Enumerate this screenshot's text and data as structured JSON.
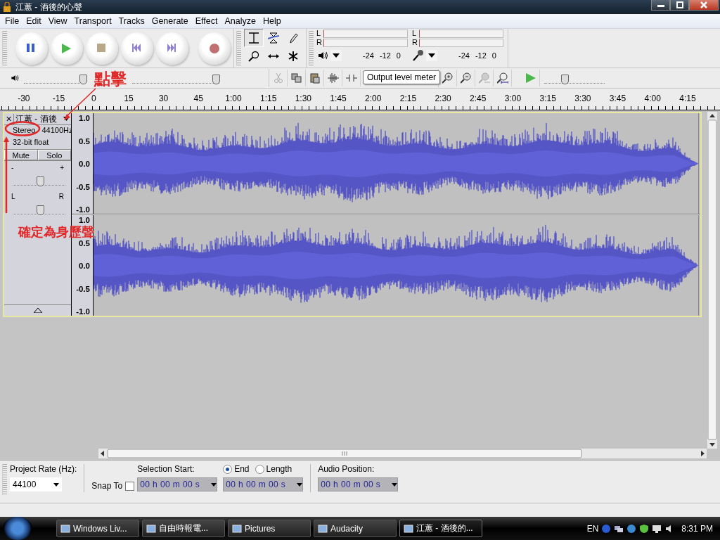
{
  "window": {
    "title": "江蕙 - 酒後的心聲"
  },
  "menu": [
    "File",
    "Edit",
    "View",
    "Transport",
    "Tracks",
    "Generate",
    "Effect",
    "Analyze",
    "Help"
  ],
  "transport": [
    {
      "kind": "pause"
    },
    {
      "kind": "play"
    },
    {
      "kind": "stop"
    },
    {
      "kind": "skip-start"
    },
    {
      "kind": "skip-end"
    },
    {
      "kind": "record"
    }
  ],
  "tools": [
    {
      "kind": "select",
      "selected": true
    },
    {
      "kind": "envelope",
      "selected": false
    },
    {
      "kind": "draw",
      "selected": false
    },
    {
      "kind": "zoom",
      "selected": false
    },
    {
      "kind": "timeshift",
      "selected": false
    },
    {
      "kind": "multi",
      "selected": false
    }
  ],
  "meters": [
    {
      "kind": "output",
      "channels": [
        "L",
        "R"
      ],
      "ticks": [
        "-24",
        "-12",
        "0"
      ]
    },
    {
      "kind": "input",
      "channels": [
        "L",
        "R"
      ],
      "ticks": [
        "-24",
        "-12",
        "0"
      ]
    }
  ],
  "mixer": {
    "playback_volume": {
      "level": 0.97
    },
    "record_volume": {
      "level": 0.95
    }
  },
  "edit_tools": [
    {
      "kind": "cut",
      "disabled": true
    },
    {
      "kind": "copy",
      "disabled": false
    },
    {
      "kind": "paste",
      "disabled": false
    },
    {
      "kind": "trim",
      "disabled": false
    },
    {
      "kind": "silence",
      "disabled": false
    }
  ],
  "tooltip": "Output level meter",
  "zoom_tools": [
    {
      "kind": "zoom-in",
      "disabled": false
    },
    {
      "kind": "zoom-out",
      "disabled": false
    },
    {
      "kind": "fit-selection",
      "disabled": true
    },
    {
      "kind": "fit-project",
      "disabled": false
    }
  ],
  "play_at_speed": {
    "level": 0.32
  },
  "ruler": {
    "ticks": [
      "-30",
      "-15",
      "0",
      "15",
      "30",
      "45",
      "1:00",
      "1:15",
      "1:30",
      "1:45",
      "2:00",
      "2:15",
      "2:30",
      "2:45",
      "3:00",
      "3:15",
      "3:30",
      "3:45",
      "4:00",
      "4:15"
    ]
  },
  "track": {
    "close": "×",
    "name": "江蕙 - 酒後",
    "channels_mode": "Stereo",
    "rate": "44100Hz",
    "format": "32-bit float",
    "mute": "Mute",
    "solo": "Solo",
    "gain": {
      "minus": "-",
      "plus": "+",
      "level": 0.5
    },
    "pan": {
      "left": "L",
      "right": "R",
      "level": 0.5
    },
    "channels": [
      {
        "scale": [
          "1.0",
          "0.5",
          "0.0",
          "-0.5",
          "-1.0"
        ]
      },
      {
        "scale": [
          "1.0",
          "0.5",
          "0.0",
          "-0.5",
          "-1.0"
        ]
      }
    ]
  },
  "selection_bar": {
    "project_rate_label": "Project Rate (Hz):",
    "project_rate": "44100",
    "snap_to": {
      "label": "Snap To",
      "checked": false
    },
    "selection_start_label": "Selection Start:",
    "selection_start": "00 h 00 m 00 s",
    "modes": [
      {
        "label": "End",
        "selected": true
      },
      {
        "label": "Length",
        "selected": false
      }
    ],
    "end_value": "00 h 00 m 00 s",
    "audio_position_label": "Audio Position:",
    "audio_position": "00 h 00 m 00 s"
  },
  "annotations": [
    {
      "kind": "click",
      "text": "點擊"
    },
    {
      "kind": "stereo",
      "text": "確定為身歷聲"
    }
  ],
  "taskbar": {
    "tasks": [
      {
        "label": "Windows Liv...",
        "selected": false
      },
      {
        "label": "自由時報電...",
        "selected": false
      },
      {
        "label": "Pictures",
        "selected": false
      },
      {
        "label": "Audacity",
        "selected": false
      },
      {
        "label": "江蕙 - 酒後的...",
        "selected": true
      }
    ],
    "language": "EN",
    "clock": "8:31 PM"
  }
}
